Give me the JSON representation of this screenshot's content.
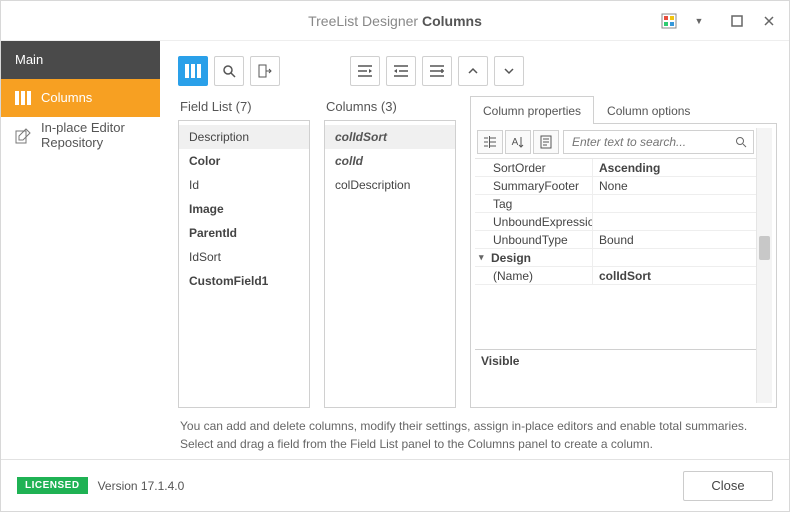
{
  "title": {
    "prefix": "TreeList Designer",
    "section": "Columns"
  },
  "sidebar": {
    "main": "Main",
    "columns": "Columns",
    "repo": "In-place Editor Repository"
  },
  "fieldList": {
    "title": "Field List (7)",
    "items": [
      {
        "label": "Description",
        "style": "sel"
      },
      {
        "label": "Color",
        "style": "bold"
      },
      {
        "label": "Id",
        "style": ""
      },
      {
        "label": "Image",
        "style": "bold"
      },
      {
        "label": "ParentId",
        "style": "bold"
      },
      {
        "label": "IdSort",
        "style": ""
      },
      {
        "label": "CustomField1",
        "style": "bold"
      }
    ]
  },
  "columns": {
    "title": "Columns (3)",
    "items": [
      {
        "label": "colIdSort",
        "style": "ital sel"
      },
      {
        "label": "colId",
        "style": "ital"
      },
      {
        "label": "colDescription",
        "style": ""
      }
    ]
  },
  "tabs": {
    "props": "Column properties",
    "opts": "Column options"
  },
  "search": {
    "placeholder": "Enter text to search..."
  },
  "grid": {
    "rows": [
      {
        "name": "SortOrder",
        "value": "Ascending",
        "vclass": "bold"
      },
      {
        "name": "SummaryFooter",
        "value": "None",
        "vclass": ""
      },
      {
        "name": "Tag",
        "value": "",
        "vclass": ""
      },
      {
        "name": "UnboundExpressio",
        "value": "",
        "vclass": ""
      },
      {
        "name": "UnboundType",
        "value": "Bound",
        "vclass": ""
      }
    ],
    "cat": "Design",
    "nameRow": {
      "name": "(Name)",
      "value": "colIdSort"
    },
    "desc": "Visible"
  },
  "hint": "You can add and delete columns, modify their settings, assign in-place editors and enable total summaries. Select and drag a field from the Field List panel to the Columns panel to create a column.",
  "footer": {
    "badge": "LICENSED",
    "version": "Version 17.1.4.0",
    "close": "Close"
  }
}
